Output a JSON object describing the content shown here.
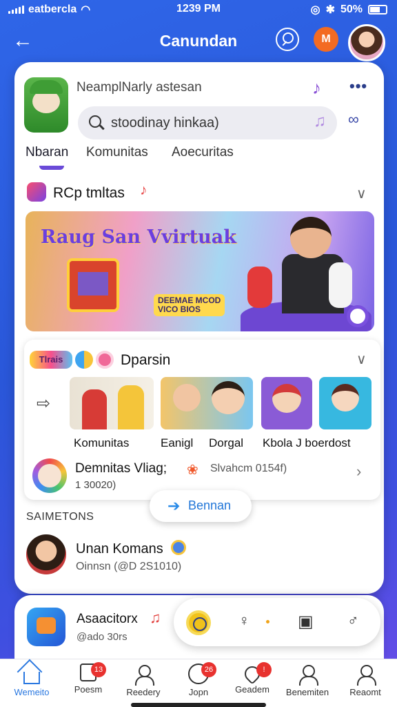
{
  "status_bar": {
    "carrier": "eatbercla",
    "time": "1239 PM",
    "battery": "50%"
  },
  "header": {
    "title": "Canundan",
    "badge": "M"
  },
  "profile": {
    "name": "NeamplNarly astesan"
  },
  "search": {
    "value": "stoodinay hinkaa)"
  },
  "tabs": [
    "Nbaran",
    "Komunitas",
    "Aoecuritas"
  ],
  "section1": {
    "title": "RCp tmltas",
    "banner_title": "Raug San Vvirtuak",
    "banner_sign_line1": "DEEMAE MCOD",
    "banner_sign_line2": "VICO BIOS"
  },
  "section2": {
    "tag": "Tlrais",
    "title": "Dparsin",
    "thumb_labels": [
      "Komunitas",
      "Eanigl",
      "Dorgal",
      "Kbola J boerdost"
    ],
    "row_title": "Demnitas Vliag;",
    "row_meta": "Slvahcm 0154f)",
    "row_count": "1 30020)"
  },
  "follow_button": {
    "label": "Bennan"
  },
  "section3": {
    "label": "SAIMETONS",
    "user_name": "Unan Komans",
    "user_handle": "Oinnsn (@D 2S1010)"
  },
  "bottom_card": {
    "title": "Asaacitorx",
    "subtitle": "@ado 30rs"
  },
  "nav": {
    "items": [
      {
        "label": "Wemeito",
        "icon": "home-icon",
        "active": true
      },
      {
        "label": "Poesm",
        "icon": "document-icon",
        "badge": "13"
      },
      {
        "label": "Reedery",
        "icon": "person-icon"
      },
      {
        "label": "Jopn",
        "icon": "smile-icon",
        "badge": "26"
      },
      {
        "label": "Geadem",
        "icon": "heart-icon",
        "badge": "!"
      },
      {
        "label": "Benemiten",
        "icon": "profile-icon"
      },
      {
        "label": "Reaomt",
        "icon": "account-icon"
      }
    ]
  },
  "colors": {
    "background": "#2f66e8",
    "accent": "#6a4ad8",
    "badge_red": "#e8322f",
    "link_blue": "#2176d8"
  }
}
